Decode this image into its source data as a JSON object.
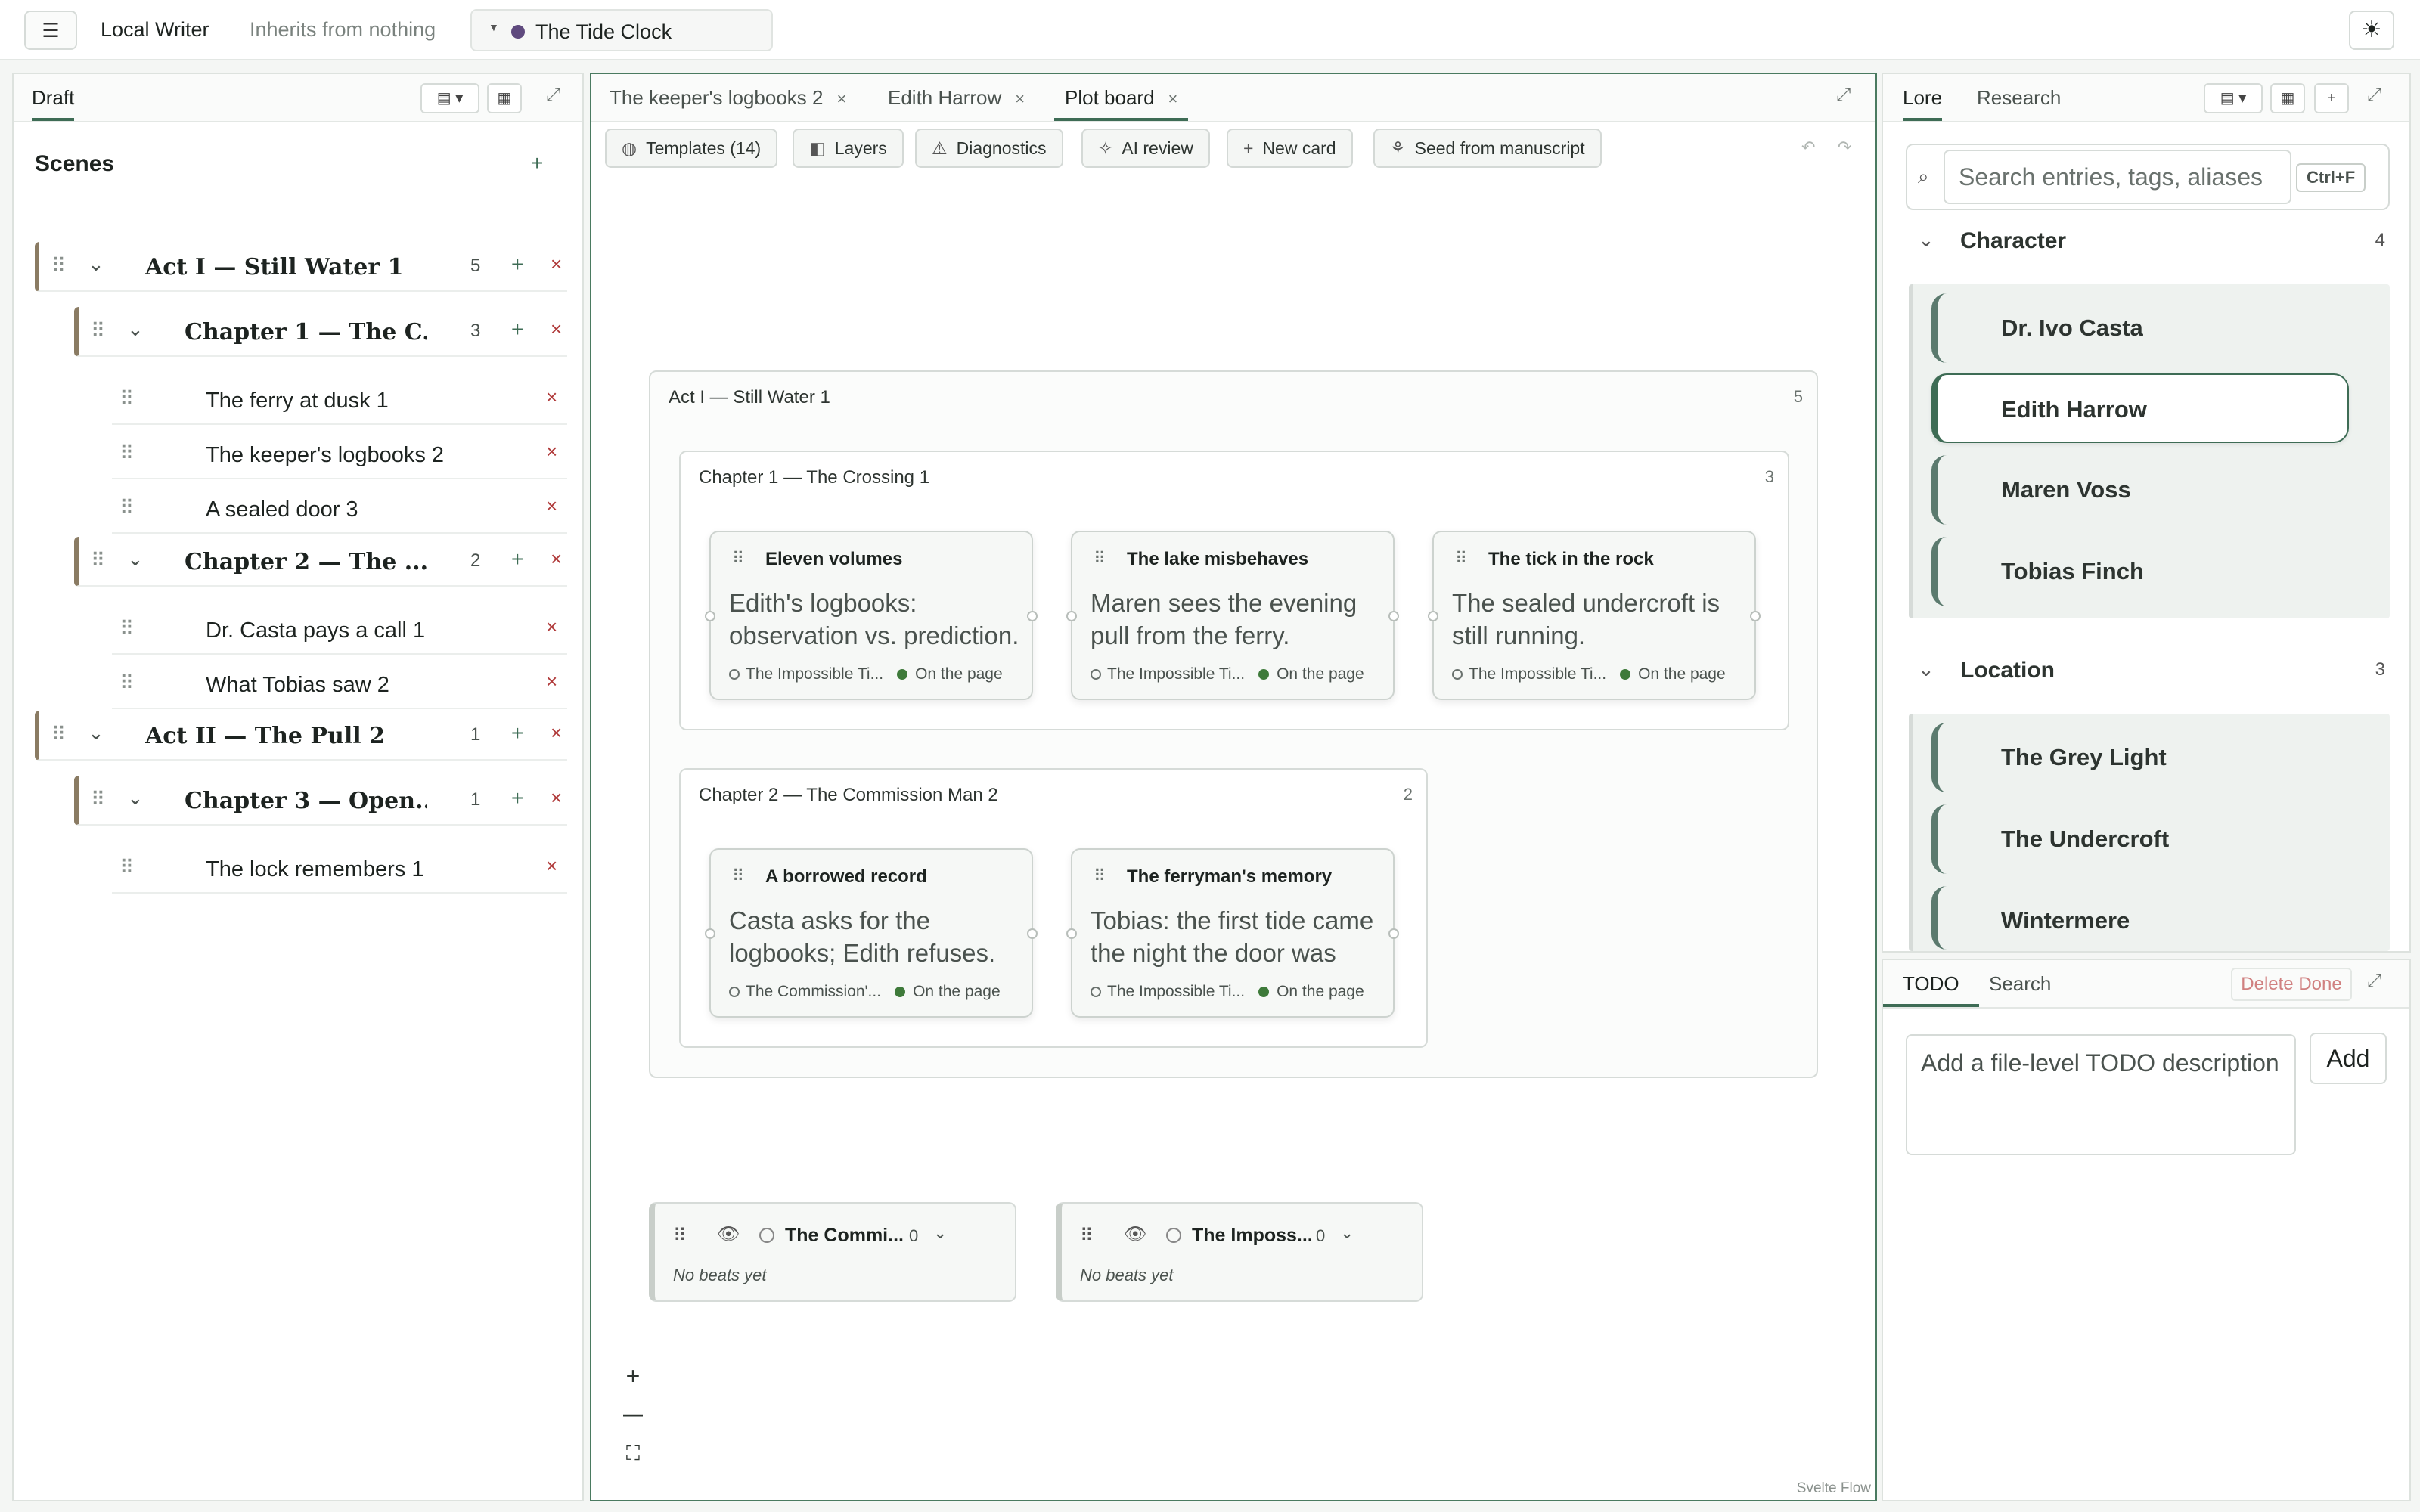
{
  "topbar": {
    "menu_icon": "hamburger-icon",
    "app_name": "Local Writer",
    "inherits": "Inherits from nothing",
    "project_name": "The Tide Clock",
    "project_color": "#5f4a7e",
    "theme_icon": "sun-icon"
  },
  "left": {
    "tab": "Draft",
    "scenes_title": "Scenes",
    "add": "+",
    "del": "×",
    "tree": {
      "act1": {
        "label": "Act I — Still Water 1",
        "count": "5"
      },
      "ch1": {
        "label": "Chapter 1 — The C...",
        "count": "3"
      },
      "s1": "The ferry at dusk 1",
      "s2": "The keeper's logbooks 2",
      "s3": "A sealed door 3",
      "ch2": {
        "label": "Chapter 2 — The ...",
        "count": "2"
      },
      "s4": "Dr. Casta pays a call 1",
      "s5": "What Tobias saw 2",
      "act2": {
        "label": "Act II — The Pull 2",
        "count": "1"
      },
      "ch3": {
        "label": "Chapter 3 — Open...",
        "count": "1"
      },
      "s6": "The lock remembers 1"
    }
  },
  "center": {
    "tabs": [
      "The keeper's logbooks 2",
      "Edith Harrow",
      "Plot board"
    ],
    "active_tab": "Plot board",
    "toolbar": {
      "templates": "Templates (14)",
      "layers": "Layers",
      "diagnostics": "Diagnostics",
      "ai_review": "AI review",
      "new_card": "New card",
      "seed": "Seed from manuscript"
    },
    "board": {
      "act": {
        "title": "Act I — Still Water 1",
        "count": "5"
      },
      "ch1": {
        "title": "Chapter 1 — The Crossing 1",
        "count": "3"
      },
      "ch2": {
        "title": "Chapter 2 — The Commission Man 2",
        "count": "2"
      },
      "on_page": "On the page",
      "cards": [
        {
          "title": "Eleven volumes",
          "body": "Edith's logbooks: observation vs. prediction.",
          "thread": "The Impossible Ti..."
        },
        {
          "title": "The lake misbehaves",
          "body": "Maren sees the evening pull from the ferry.",
          "thread": "The Impossible Ti..."
        },
        {
          "title": "The tick in the rock",
          "body": "The sealed undercroft is still running.",
          "thread": "The Impossible Ti..."
        },
        {
          "title": "A borrowed record",
          "body": "Casta asks for the logbooks; Edith refuses.",
          "thread": "The Commission'..."
        },
        {
          "title": "The ferryman's memory",
          "body": "Tobias: the first tide came the night the door was sealed.",
          "thread": "The Impossible Ti..."
        }
      ],
      "lanes": [
        {
          "name": "The Commi...",
          "count": "0",
          "empty": "No beats yet"
        },
        {
          "name": "The Imposs...",
          "count": "0",
          "empty": "No beats yet"
        }
      ],
      "zoom_in": "+",
      "zoom_out": "—",
      "fit": "⛶",
      "credit": "Svelte Flow"
    }
  },
  "lore": {
    "tabs": [
      "Lore",
      "Research"
    ],
    "search_placeholder": "Search entries, tags, aliases",
    "search_shortcut": "Ctrl+F",
    "sections": [
      {
        "name": "Character",
        "count": "4",
        "items": [
          "Dr. Ivo Casta",
          "Edith Harrow",
          "Maren Voss",
          "Tobias Finch"
        ],
        "selected": "Edith Harrow"
      },
      {
        "name": "Location",
        "count": "3",
        "items": [
          "The Grey Light",
          "The Undercroft",
          "Wintermere"
        ]
      }
    ]
  },
  "todo": {
    "tabs": [
      "TODO",
      "Search"
    ],
    "delete_done": "Delete Done",
    "placeholder": "Add a file-level TODO description",
    "add": "Add"
  }
}
